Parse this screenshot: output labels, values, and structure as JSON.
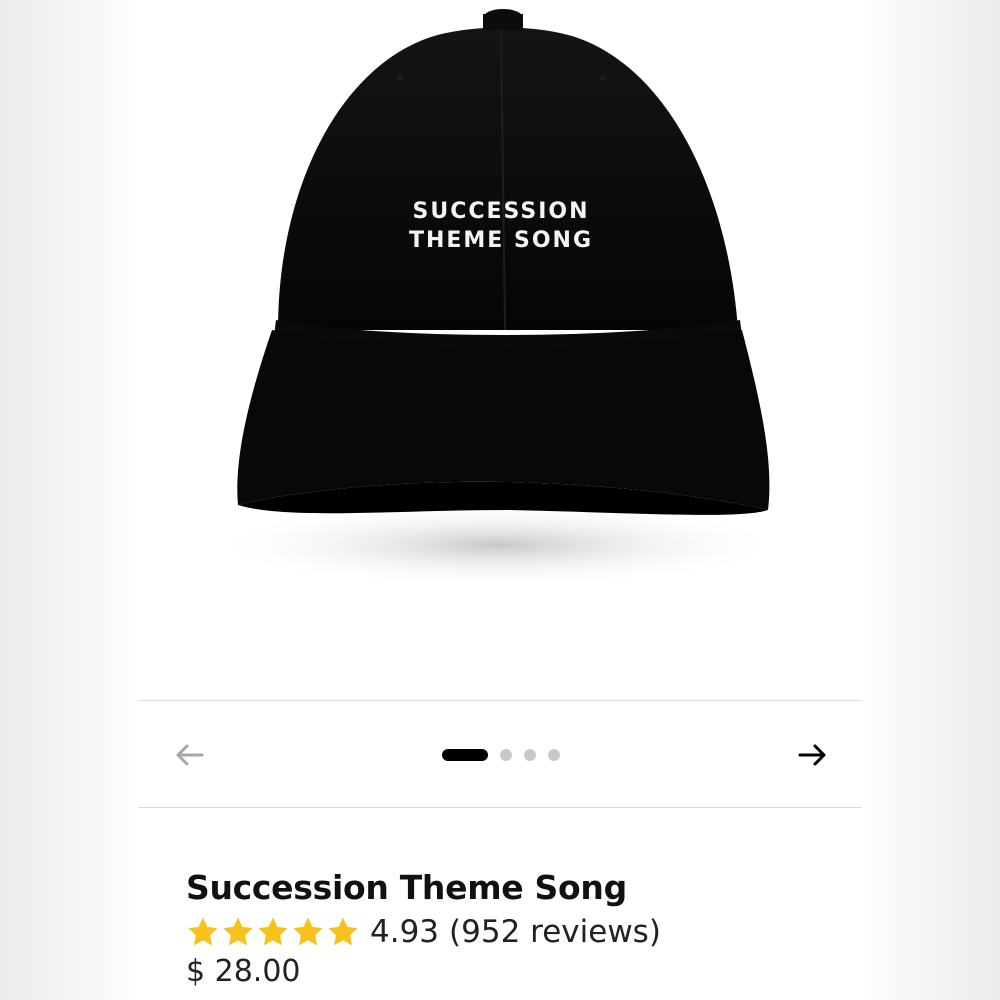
{
  "product": {
    "image": {
      "hat_text_line1": "SUCCESSION",
      "hat_text_line2": "THEME SONG"
    },
    "title": "Succession Theme Song",
    "rating": {
      "stars": 5,
      "value": "4.93",
      "reviews_text": "(952 reviews)",
      "star_color": "#f7c21b"
    },
    "price": "$ 28.00"
  },
  "carousel": {
    "prev_icon": "arrow-left-icon",
    "next_icon": "arrow-right-icon",
    "slide_count": 4,
    "active_index": 0
  }
}
